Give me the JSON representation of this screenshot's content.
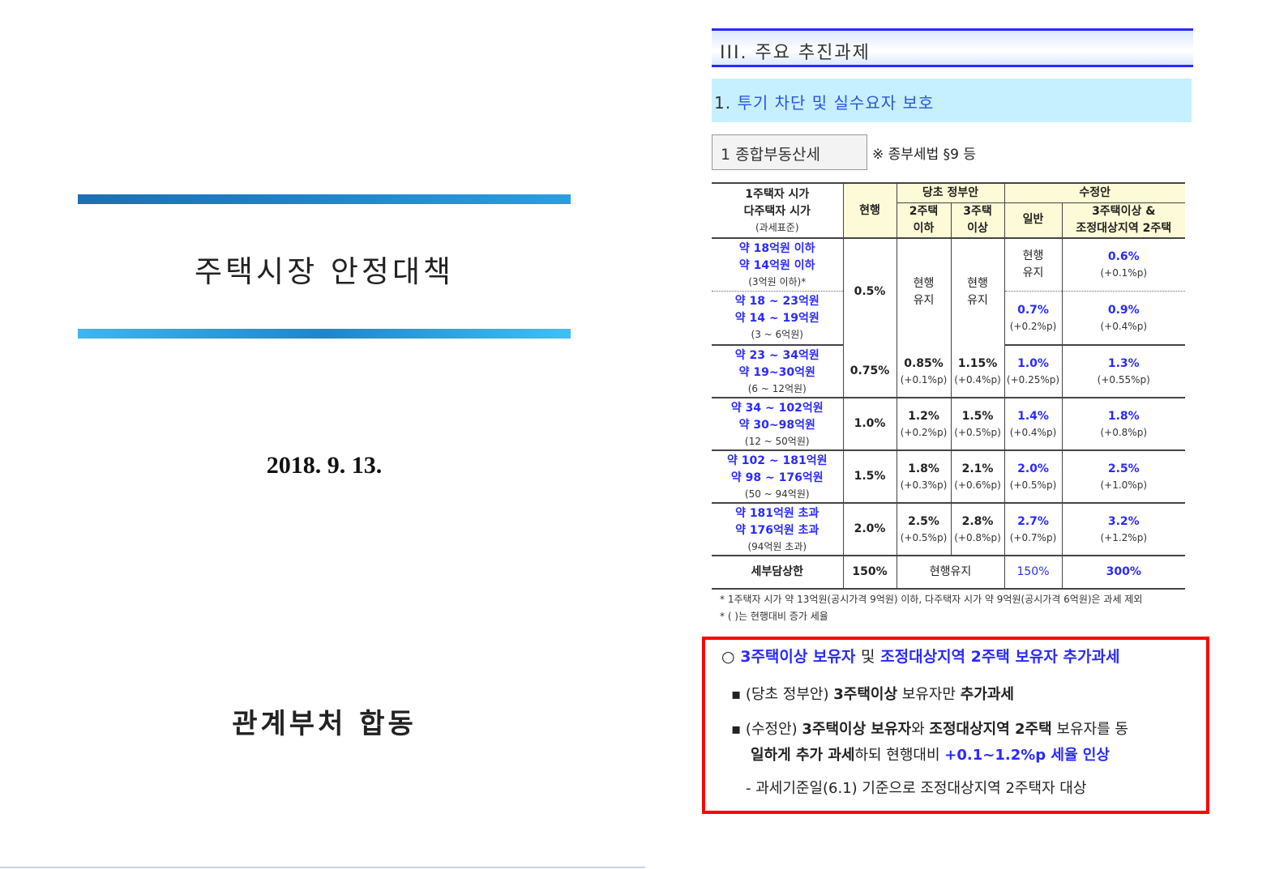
{
  "cover": {
    "title": "주택시장 안정대책",
    "date": "2018. 9. 13.",
    "org": "관계부처 합동"
  },
  "section": {
    "title": "III. 주요 추진과제",
    "subtitle_num": "1.",
    "subtitle": "투기 차단 및 실수요자 보호",
    "box": "1  종합부동산세",
    "ref": "※ 종부세법 §9 등"
  },
  "table": {
    "h_label": [
      "1주택자 시가",
      "다주택자 시가",
      "(과세표준)"
    ],
    "h_current": "현행",
    "h_orig": "당초 정부안",
    "h_rev": "수정안",
    "h_orig2": [
      "2주택",
      "이하"
    ],
    "h_orig3": [
      "3주택",
      "이상"
    ],
    "h_gen": "일반",
    "h_multi": [
      "3주택이상 &",
      "조정대상지역 2주택"
    ],
    "rowA": {
      "label": [
        "약 18억원 이하",
        "약 14억원 이하",
        "(3억원 이하)*"
      ],
      "current": "0.5%",
      "orig_keep": [
        "현행",
        "유지"
      ],
      "gen_keep": [
        "현행",
        "유지"
      ],
      "multi": "0.6%",
      "multi_d": "(+0.1%p)"
    },
    "rowB": {
      "label": [
        "약 18 ~ 23억원",
        "약 14 ~ 19억원",
        "(3 ~ 6억원)"
      ],
      "gen": "0.7%",
      "gen_d": "(+0.2%p)",
      "multi": "0.9%",
      "multi_d": "(+0.4%p)"
    },
    "rows": [
      {
        "label": [
          "약 23 ~ 34억원",
          "약 19~30억원",
          "(6 ~ 12억원)"
        ],
        "current": "0.75%",
        "o2": "0.85%",
        "o2d": "(+0.1%p)",
        "o3": "1.15%",
        "o3d": "(+0.4%p)",
        "gen": "1.0%",
        "gend": "(+0.25%p)",
        "multi": "1.3%",
        "multid": "(+0.55%p)"
      },
      {
        "label": [
          "약 34 ~ 102억원",
          "약 30~98억원",
          "(12 ~ 50억원)"
        ],
        "current": "1.0%",
        "o2": "1.2%",
        "o2d": "(+0.2%p)",
        "o3": "1.5%",
        "o3d": "(+0.5%p)",
        "gen": "1.4%",
        "gend": "(+0.4%p)",
        "multi": "1.8%",
        "multid": "(+0.8%p)"
      },
      {
        "label": [
          "약 102 ~ 181억원",
          "약 98 ~ 176억원",
          "(50 ~ 94억원)"
        ],
        "current": "1.5%",
        "o2": "1.8%",
        "o2d": "(+0.3%p)",
        "o3": "2.1%",
        "o3d": "(+0.6%p)",
        "gen": "2.0%",
        "gend": "(+0.5%p)",
        "multi": "2.5%",
        "multid": "(+1.0%p)"
      },
      {
        "label": [
          "약 181억원 초과",
          "약 176억원 초과",
          "(94억원 초과)"
        ],
        "current": "2.0%",
        "o2": "2.5%",
        "o2d": "(+0.5%p)",
        "o3": "2.8%",
        "o3d": "(+0.8%p)",
        "gen": "2.7%",
        "gend": "(+0.7%p)",
        "multi": "3.2%",
        "multid": "(+1.2%p)"
      }
    ],
    "cap": {
      "label": "세부담상한",
      "current": "150%",
      "orig": "현행유지",
      "gen": "150%",
      "multi": "300%"
    },
    "notes": [
      "* 1주택자 시가 약 13억원(공시가격 9억원) 이하, 다주택자 시가 약 9억원(공시가격 6억원)은 과세 제외",
      "* (   )는 현행대비 증가 세율"
    ]
  },
  "highlight": {
    "bullet": "○",
    "title_a": "3주택이상 보유자",
    "title_b": "및",
    "title_c": "조정대상지역 2주택 보유자 추가과세",
    "l1_a": "▪ (당초 정부안)",
    "l1_b": "3주택이상",
    "l1_c": "보유자만",
    "l1_d": "추가과세",
    "l2_a": "▪ (수정안)",
    "l2_b": "3주택이상 보유자",
    "l2_c": "와",
    "l2_d": "조정대상지역 2주택",
    "l2_e": "보유자를 동",
    "l3_a": "일하게 추가 과세",
    "l3_b": "하되 현행대비",
    "l3_c": "+0.1~1.2%p 세율 인상",
    "l4": "- 과세기준일(6.1) 기준으로 조정대상지역 2주택자 대상"
  },
  "colors": {
    "accent_blue": "#2a2aff",
    "highlight_red": "#ff0000",
    "subhead_bg": "#c6f0ff"
  }
}
